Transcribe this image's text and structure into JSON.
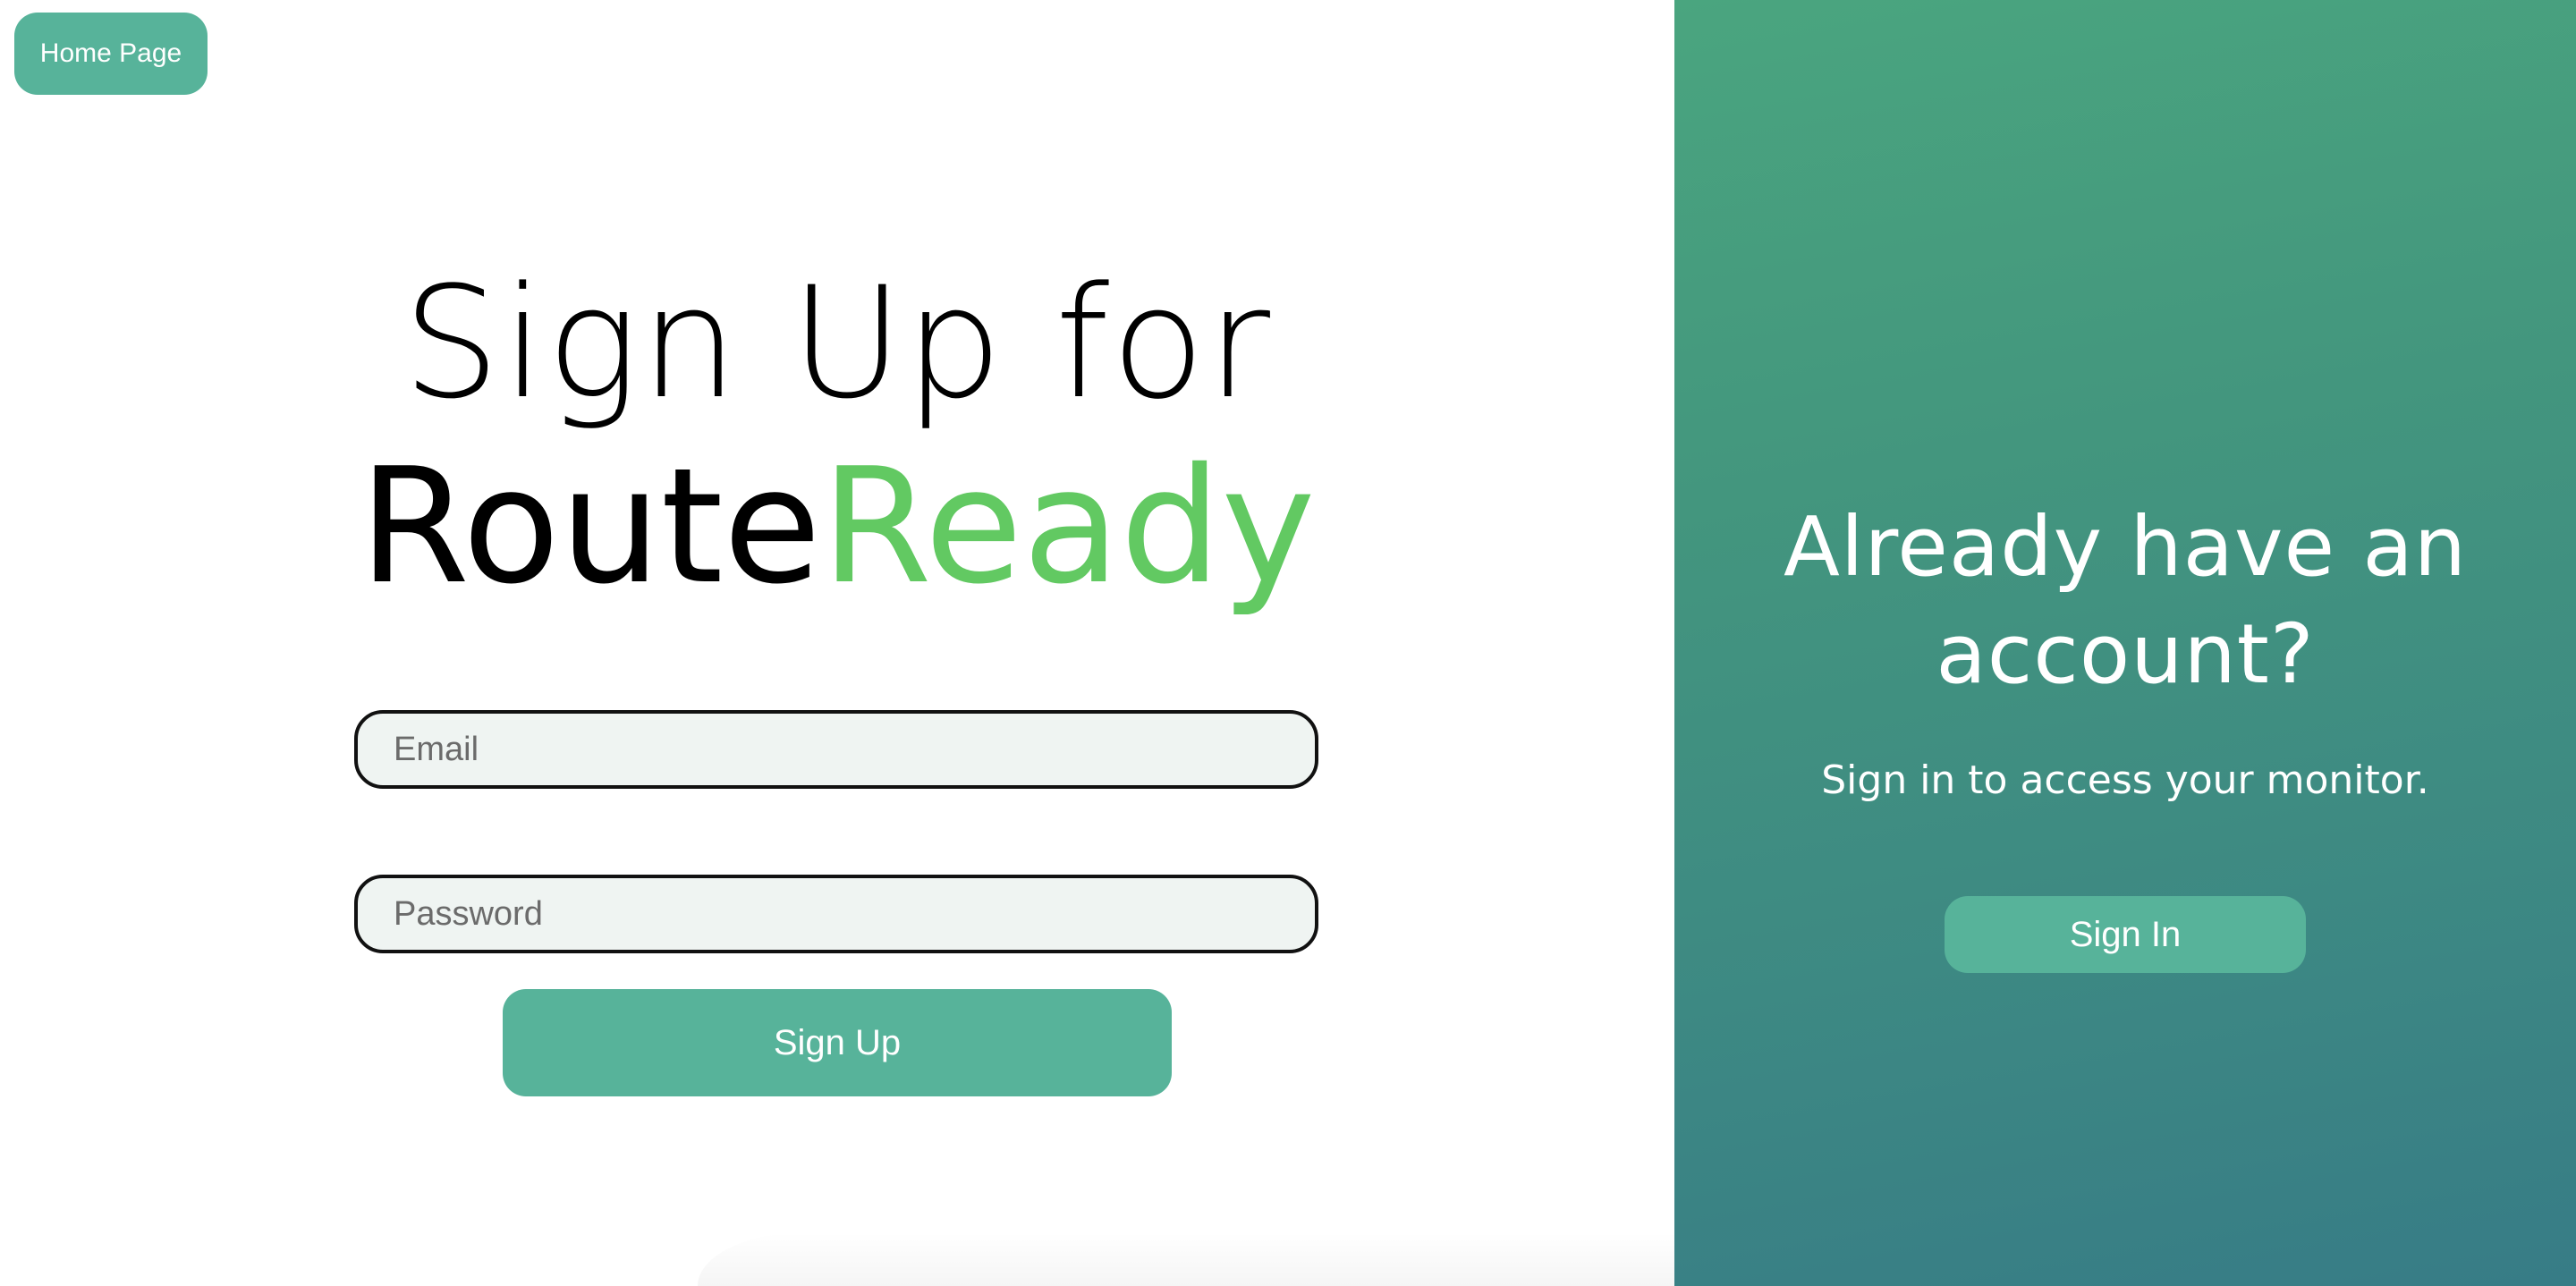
{
  "nav": {
    "home_label": "Home Page"
  },
  "signup": {
    "title_line1": "Sign Up for",
    "brand_part1": "Route",
    "brand_part2": "Ready",
    "email_placeholder": "Email",
    "password_placeholder": "Password",
    "submit_label": "Sign Up"
  },
  "signin_panel": {
    "title": "Already have an account?",
    "subtitle": "Sign in to access your monitor.",
    "button_label": "Sign In"
  },
  "colors": {
    "accent": "#57b39a",
    "brand_green": "#62c962",
    "panel_gradient_top": "#4aa57f",
    "panel_gradient_bottom": "#377c86",
    "field_background": "#eff4f2"
  }
}
